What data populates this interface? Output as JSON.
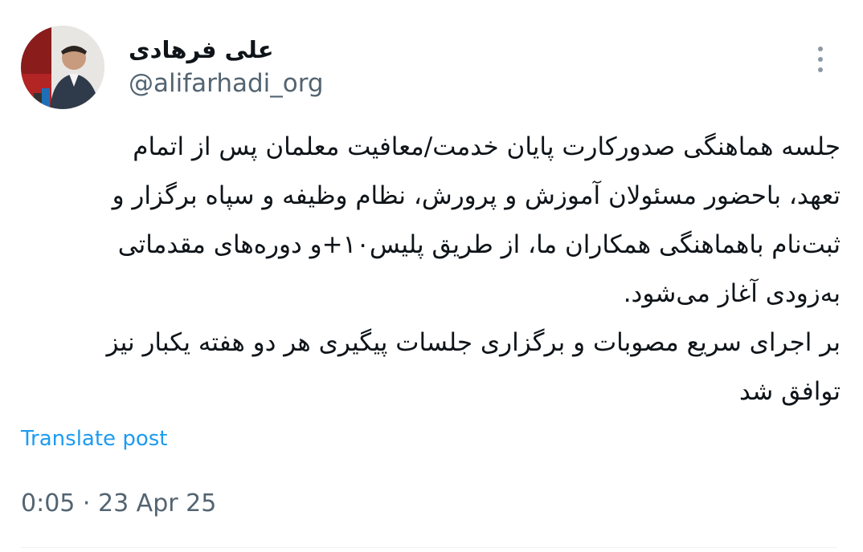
{
  "author": {
    "display_name": "علی فرهادی",
    "handle": "@alifarhadi_org",
    "avatar_icon": "profile-photo"
  },
  "tweet": {
    "lines": [
      "جلسه هماهنگی صدورکارت پایان خدمت/معافیت معلمان پس از اتمام",
      "تعهد، باحضور مسئولان آموزش و پرورش، نظام وظیفه و سپاه برگزار و",
      "ثبت‌نام باهماهنگی همکاران ما، از طریق پلیس۱۰+و دوره‌های مقدماتی",
      "به‌زودی آغاز می‌شود.",
      "بر اجرای سریع مصوبات و برگزاری جلسات پیگیری هر دو هفته یکبار نیز",
      "توافق شد"
    ]
  },
  "translate_label": "Translate post",
  "timestamp": "0:05 · 23 Apr 25",
  "more_icon": "more-vertical-icon",
  "colors": {
    "text": "#0f1419",
    "secondary": "#536471",
    "link": "#1d9bf0",
    "divider": "#eff3f4"
  }
}
